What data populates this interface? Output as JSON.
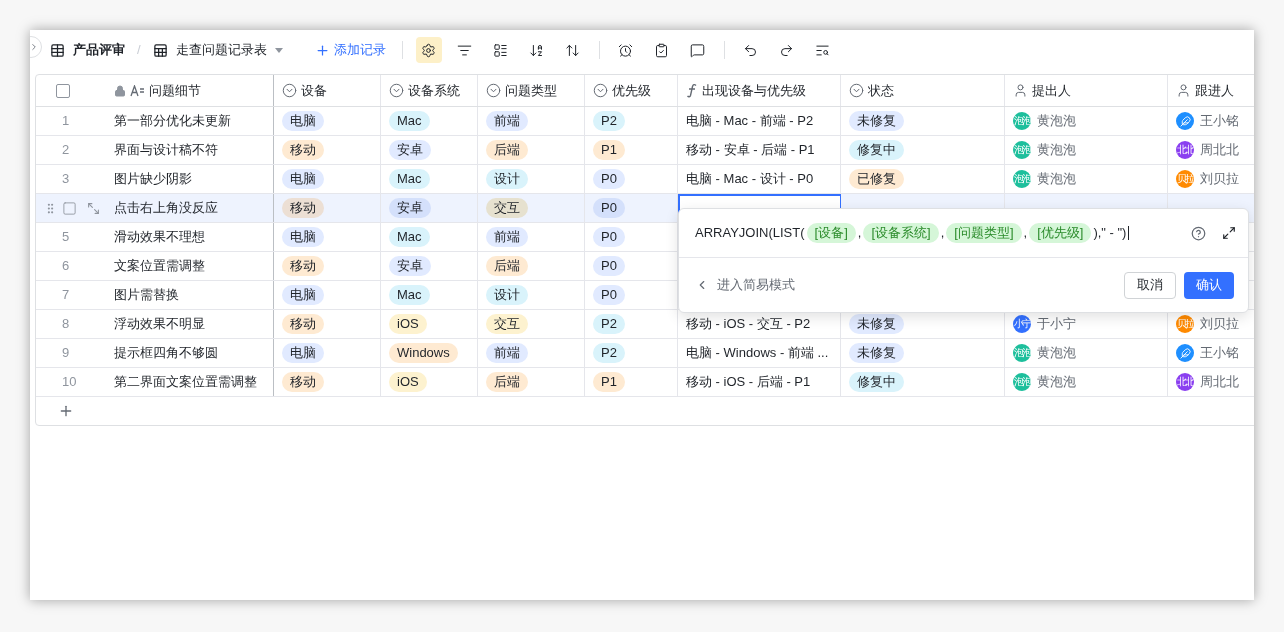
{
  "toolbar": {
    "base_name": "产品评审",
    "separator": "/",
    "table_name": "走查问题记录表",
    "add_record": "添加记录",
    "tools": [
      {
        "kind": "settings",
        "selected": true
      },
      {
        "kind": "filter",
        "selected": false
      },
      {
        "kind": "group",
        "selected": false
      },
      {
        "kind": "sort",
        "selected": false
      },
      {
        "kind": "row-height",
        "selected": false
      },
      {
        "kind": "divider"
      },
      {
        "kind": "alarm",
        "selected": false
      },
      {
        "kind": "form",
        "selected": false
      },
      {
        "kind": "comment",
        "selected": false
      },
      {
        "kind": "divider"
      },
      {
        "kind": "undo",
        "selected": false
      },
      {
        "kind": "redo",
        "selected": false
      },
      {
        "kind": "search",
        "selected": false
      }
    ]
  },
  "table": {
    "select_all_checked": false,
    "columns": [
      {
        "kind": "text",
        "label": "问题细节"
      },
      {
        "kind": "select",
        "label": "设备"
      },
      {
        "kind": "select",
        "label": "设备系统"
      },
      {
        "kind": "select",
        "label": "问题类型"
      },
      {
        "kind": "select",
        "label": "优先级"
      },
      {
        "kind": "formula",
        "label": "出现设备与优先级"
      },
      {
        "kind": "select",
        "label": "状态"
      },
      {
        "kind": "person",
        "label": "提出人"
      },
      {
        "kind": "person",
        "label": "跟进人"
      }
    ],
    "rows": [
      {
        "number": "1",
        "hovered": false,
        "formula_selected": false,
        "detail": "第一部分优化未更新",
        "device": {
          "text": "电脑",
          "color": "#e1eaff"
        },
        "os": {
          "text": "Mac",
          "color": "#d9f3fb"
        },
        "type": {
          "text": "前端",
          "color": "#e1eaff"
        },
        "priority": {
          "text": "P2",
          "color": "#d9f3fb"
        },
        "formula": "电脑 - Mac - 前端 - P2",
        "status": {
          "text": "未修复",
          "color": "#e1eaff"
        },
        "reporter": {
          "name": "黄泡泡",
          "avatar": {
            "kind": "text",
            "text": "泡泡",
            "color": "#1dbf9c"
          }
        },
        "assignee": {
          "name": "王小铭",
          "avatar": {
            "kind": "feather",
            "color": "#1e8fff"
          }
        }
      },
      {
        "number": "2",
        "hovered": false,
        "formula_selected": false,
        "detail": "界面与设计稿不符",
        "device": {
          "text": "移动",
          "color": "#feead2"
        },
        "os": {
          "text": "安卓",
          "color": "#e1eaff"
        },
        "type": {
          "text": "后端",
          "color": "#feead2"
        },
        "priority": {
          "text": "P1",
          "color": "#feead2"
        },
        "formula": "移动 - 安卓 - 后端 - P1",
        "status": {
          "text": "修复中",
          "color": "#d9f3fb"
        },
        "reporter": {
          "name": "黄泡泡",
          "avatar": {
            "kind": "text",
            "text": "泡泡",
            "color": "#1dbf9c"
          }
        },
        "assignee": {
          "name": "周北北",
          "avatar": {
            "kind": "text",
            "text": "北北",
            "color": "#8a3ff0"
          }
        }
      },
      {
        "number": "3",
        "hovered": false,
        "formula_selected": false,
        "detail": "图片缺少阴影",
        "device": {
          "text": "电脑",
          "color": "#e1eaff"
        },
        "os": {
          "text": "Mac",
          "color": "#d9f3fb"
        },
        "type": {
          "text": "设计",
          "color": "#d9f3fb"
        },
        "priority": {
          "text": "P0",
          "color": "#e1eaff"
        },
        "formula": "电脑 - Mac - 设计 - P0",
        "status": {
          "text": "已修复",
          "color": "#feead2"
        },
        "reporter": {
          "name": "黄泡泡",
          "avatar": {
            "kind": "text",
            "text": "泡泡",
            "color": "#1dbf9c"
          }
        },
        "assignee": {
          "name": "刘贝拉",
          "avatar": {
            "kind": "text",
            "text": "贝拉",
            "color": "#ff8a00"
          }
        }
      },
      {
        "hovered": true,
        "formula_selected": true,
        "detail": "点击右上角没反应",
        "device": {
          "text": "移动",
          "color": "#ecdfd4"
        },
        "os": {
          "text": "安卓",
          "color": "#d4e0fb"
        },
        "type": {
          "text": "交互",
          "color": "#e6e1cf"
        },
        "priority": {
          "text": "P0",
          "color": "#d4e0fb"
        }
      },
      {
        "number": "5",
        "hovered": false,
        "detail": "滑动效果不理想",
        "device": {
          "text": "电脑",
          "color": "#e1eaff"
        },
        "os": {
          "text": "Mac",
          "color": "#d9f3fb"
        },
        "type": {
          "text": "前端",
          "color": "#e1eaff"
        },
        "priority": {
          "text": "P0",
          "color": "#e1eaff"
        }
      },
      {
        "number": "6",
        "hovered": false,
        "detail": "文案位置需调整",
        "device": {
          "text": "移动",
          "color": "#feead2"
        },
        "os": {
          "text": "安卓",
          "color": "#e1eaff"
        },
        "type": {
          "text": "后端",
          "color": "#feead2"
        },
        "priority": {
          "text": "P0",
          "color": "#e1eaff"
        }
      },
      {
        "number": "7",
        "hovered": false,
        "detail": "图片需替换",
        "device": {
          "text": "电脑",
          "color": "#e1eaff"
        },
        "os": {
          "text": "Mac",
          "color": "#d9f3fb"
        },
        "type": {
          "text": "设计",
          "color": "#d9f3fb"
        },
        "priority": {
          "text": "P0",
          "color": "#e1eaff"
        }
      },
      {
        "number": "8",
        "hovered": false,
        "formula_selected": false,
        "detail": "浮动效果不明显",
        "device": {
          "text": "移动",
          "color": "#feead2"
        },
        "os": {
          "text": "iOS",
          "color": "#fdf2cf"
        },
        "type": {
          "text": "交互",
          "color": "#fdf2cf"
        },
        "priority": {
          "text": "P2",
          "color": "#d9f3fb"
        },
        "formula": "移动 - iOS - 交互 - P2",
        "status": {
          "text": "未修复",
          "color": "#e1eaff"
        },
        "reporter": {
          "name": "于小宁",
          "avatar": {
            "kind": "text",
            "text": "小宁",
            "color": "#3370ff"
          }
        },
        "assignee": {
          "name": "刘贝拉",
          "avatar": {
            "kind": "text",
            "text": "贝拉",
            "color": "#ff8a00"
          }
        }
      },
      {
        "number": "9",
        "hovered": false,
        "formula_selected": false,
        "detail": "提示框四角不够圆",
        "device": {
          "text": "电脑",
          "color": "#e1eaff"
        },
        "os": {
          "text": "Windows",
          "color": "#feead2"
        },
        "type": {
          "text": "前端",
          "color": "#e1eaff"
        },
        "priority": {
          "text": "P2",
          "color": "#d9f3fb"
        },
        "formula": "电脑 - Windows - 前端 ...",
        "status": {
          "text": "未修复",
          "color": "#e1eaff"
        },
        "reporter": {
          "name": "黄泡泡",
          "avatar": {
            "kind": "text",
            "text": "泡泡",
            "color": "#1dbf9c"
          }
        },
        "assignee": {
          "name": "王小铭",
          "avatar": {
            "kind": "feather",
            "color": "#1e8fff"
          }
        }
      },
      {
        "number": "10",
        "hovered": false,
        "formula_selected": false,
        "detail": "第二界面文案位置需调整",
        "device": {
          "text": "移动",
          "color": "#feead2"
        },
        "os": {
          "text": "iOS",
          "color": "#fdf2cf"
        },
        "type": {
          "text": "后端",
          "color": "#feead2"
        },
        "priority": {
          "text": "P1",
          "color": "#feead2"
        },
        "formula": "移动 - iOS - 后端 - P1",
        "status": {
          "text": "修复中",
          "color": "#d9f3fb"
        },
        "reporter": {
          "name": "黄泡泡",
          "avatar": {
            "kind": "text",
            "text": "泡泡",
            "color": "#1dbf9c"
          }
        },
        "assignee": {
          "name": "周北北",
          "avatar": {
            "kind": "text",
            "text": "北北",
            "color": "#8a3ff0"
          }
        }
      }
    ]
  },
  "formula_editor": {
    "parts": [
      {
        "kind": "text",
        "text": "ARRAYJOIN(LIST("
      },
      {
        "kind": "field",
        "text": "[设备]"
      },
      {
        "kind": "text",
        "text": ","
      },
      {
        "kind": "field",
        "text": "[设备系统]"
      },
      {
        "kind": "text",
        "text": ","
      },
      {
        "kind": "field",
        "text": "[问题类型]"
      },
      {
        "kind": "text",
        "text": ","
      },
      {
        "kind": "field",
        "text": "[优先级]"
      },
      {
        "kind": "text",
        "text": "),\" - \")"
      }
    ],
    "simple_mode": "进入简易模式",
    "cancel": "取消",
    "confirm": "确认"
  }
}
